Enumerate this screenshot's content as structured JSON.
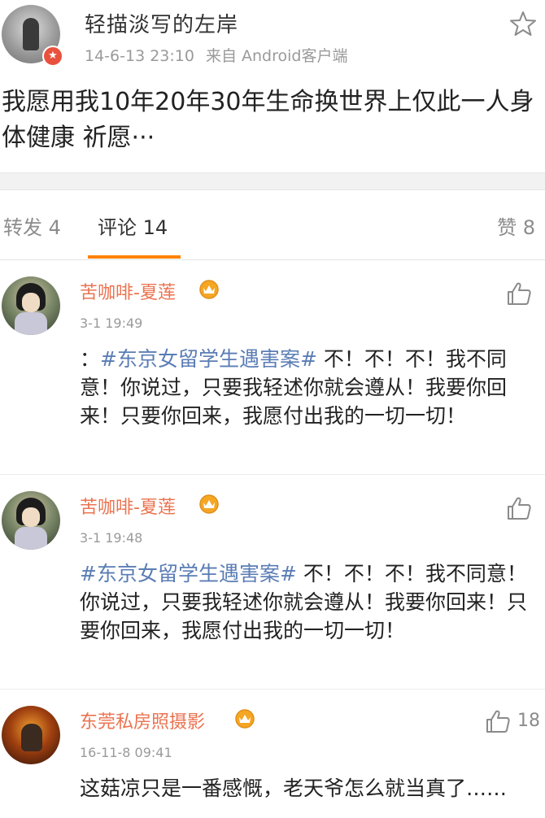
{
  "post": {
    "author": "轻描淡写的左岸",
    "time": "14-6-13 23:10",
    "source": "来自 Android客户端",
    "text": "我愿用我10年20年30年生命换世界上仅此一人身体健康 祈愿···"
  },
  "tabs": {
    "repost": "转发 4",
    "comments": "评论 14",
    "likes": "赞 8"
  },
  "comments": [
    {
      "user": "苦咖啡-夏莲",
      "time": "3-1 19:49",
      "prefix": "：",
      "hashtag": "#东京女留学生遇害案#",
      "text": " 不！不！不！我不同意！你说过，只要我轻述你就会遵从！我要你回来！只要你回来，我愿付出我的一切一切！"
    },
    {
      "user": "苦咖啡-夏莲",
      "time": "3-1 19:48",
      "prefix": "",
      "hashtag": "#东京女留学生遇害案#",
      "text": " 不！不！不！我不同意！你说过，只要我轻述你就会遵从！我要你回来！只要你回来，我愿付出我的一切一切！"
    },
    {
      "user": "东莞私房照摄影",
      "time": "16-11-8 09:41",
      "like_count": "18",
      "prefix": "",
      "hashtag": "",
      "text": "这菇凉只是一番感慨，老天爷怎么就当真了……"
    }
  ],
  "colors": {
    "accent": "#ff8200",
    "username": "#eb7350",
    "hashtag": "#5a7db5",
    "vip": "#f5a623",
    "verified": "#e8523d"
  }
}
